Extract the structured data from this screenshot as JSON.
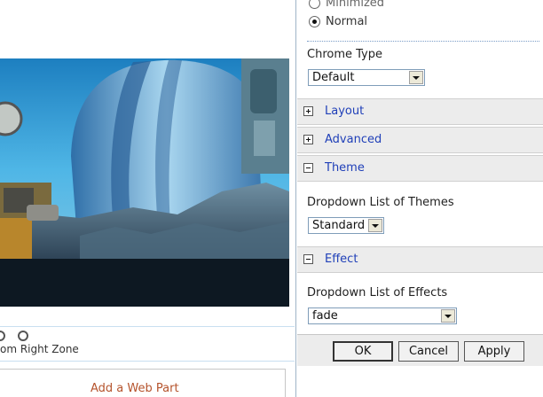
{
  "appearance": {
    "chrome_state_options": [
      {
        "label": "Minimized",
        "checked": false
      },
      {
        "label": "Normal",
        "checked": true
      }
    ],
    "chrome_type_label": "Chrome Type",
    "chrome_type_value": "Default"
  },
  "sections": {
    "layout": {
      "title": "Layout",
      "expanded": false
    },
    "advanced": {
      "title": "Advanced",
      "expanded": false
    },
    "theme": {
      "title": "Theme",
      "expanded": true,
      "field_label": "Dropdown List of Themes",
      "value": "Standard"
    },
    "effect": {
      "title": "Effect",
      "expanded": true,
      "field_label": "Dropdown List of Effects",
      "value": "fade"
    }
  },
  "buttons": {
    "ok": "OK",
    "cancel": "Cancel",
    "apply": "Apply"
  },
  "zone": {
    "label": "om Right Zone"
  },
  "add_web_part": "Add a Web Part",
  "colors": {
    "section_title": "#1f3fb8",
    "add_web_part_link": "#b5532c",
    "pane_border": "#9fb4c8"
  }
}
